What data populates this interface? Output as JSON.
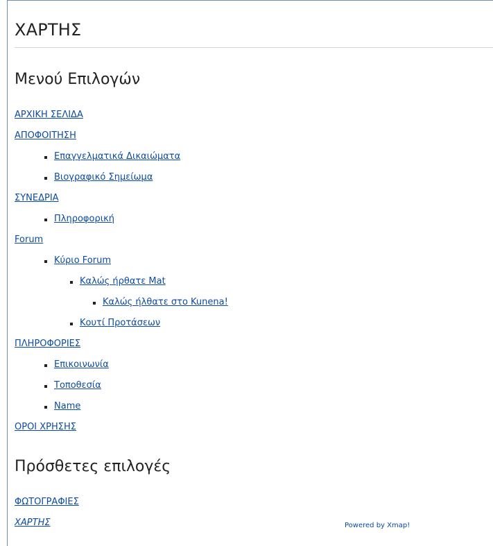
{
  "page": {
    "title": "ΧΑΡΤΗΣ"
  },
  "menu": {
    "heading": "Μενού Επιλογών",
    "items": [
      {
        "label": "ΑΡΧΙΚΗ ΣΕΛΙΔΑ",
        "level": 0
      },
      {
        "label": "ΑΠΟΦΟΙΤΗΣΗ",
        "level": 0
      },
      {
        "label": "Επαγγελματικά Δικαιώματα",
        "level": 1
      },
      {
        "label": "Βιογραφικό Σημείωμα",
        "level": 1
      },
      {
        "label": "ΣΥΝΕΔΡΙΑ",
        "level": 0
      },
      {
        "label": "Πληροφορική",
        "level": 1
      },
      {
        "label": "Forum",
        "level": 0
      },
      {
        "label": "Κύριο Forum",
        "level": 1
      },
      {
        "label": "Καλώς ήρθατε Mat",
        "level": 2
      },
      {
        "label": "Καλώς ήλθατε στο Kunena!",
        "level": 3
      },
      {
        "label": "Κουτί Προτάσεων",
        "level": 2
      },
      {
        "label": "ΠΛΗΡΟΦΟΡΙΕΣ",
        "level": 0
      },
      {
        "label": "Επικοινωνία",
        "level": 1
      },
      {
        "label": "Τοποθεσία",
        "level": 1
      },
      {
        "label": "Name",
        "level": 1
      },
      {
        "label": "ΟΡΟΙ ΧΡΗΣΗΣ",
        "level": 0
      }
    ]
  },
  "extra": {
    "heading": "Πρόσθετες επιλογές",
    "items": [
      {
        "label": "ΦΩΤΟΓΡΑΦΙΕΣ",
        "italic": false
      },
      {
        "label": "ΧΑΡΤΗΣ",
        "italic": true
      }
    ]
  },
  "footer": {
    "powered_by": "Powered by Xmap!"
  },
  "colors": {
    "link": "#0b4ba6",
    "heading": "#222222",
    "frame_border": "#6f8fb2"
  }
}
